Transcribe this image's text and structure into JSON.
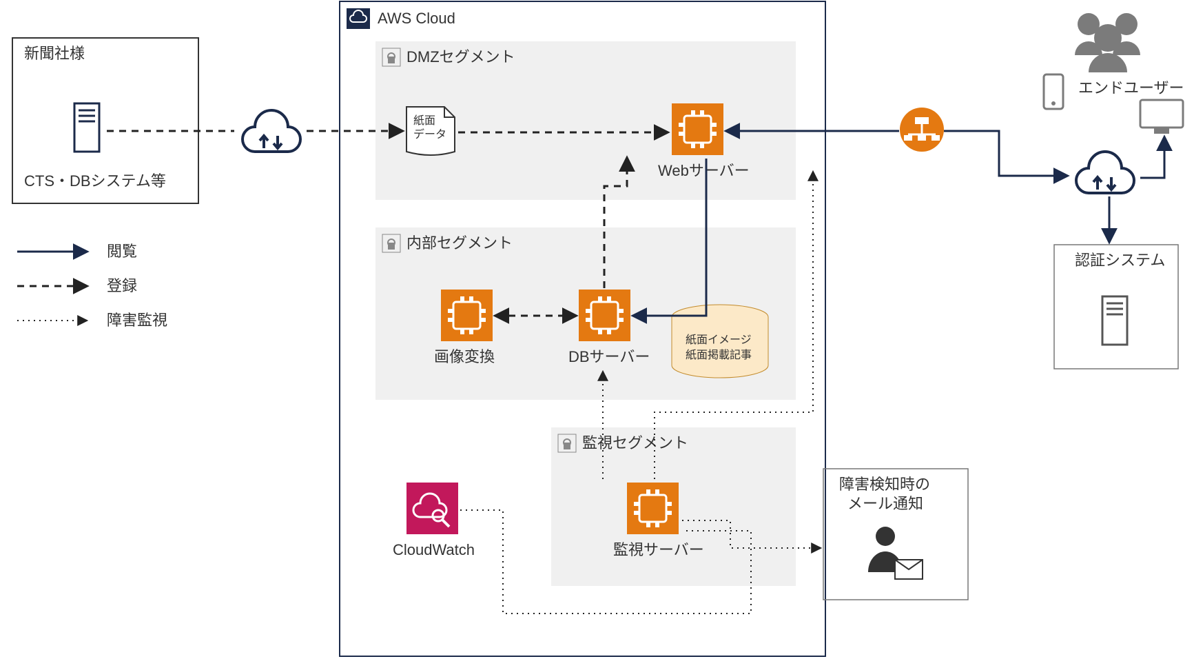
{
  "diagram": {
    "onprem": {
      "title": "新聞社様",
      "subtitle": "CTS・DBシステム等"
    },
    "cloud": {
      "title": "AWS Cloud"
    },
    "segments": {
      "dmz": {
        "title": "DMZセグメント"
      },
      "internal": {
        "title": "内部セグメント"
      },
      "monitor": {
        "title": "監視セグメント"
      }
    },
    "nodes": {
      "paperdata": "紙面\nデータ",
      "webserver": "Webサーバー",
      "imgconv": "画像変換",
      "dbserver": "DBサーバー",
      "storage_l1": "紙面イメージ",
      "storage_l2": "紙面掲載記事",
      "cloudwatch": "CloudWatch",
      "monitorsrv": "監視サーバー",
      "alert_l1": "障害検知時の",
      "alert_l2": "メール通知",
      "enduser": "エンドユーザー",
      "auth": "認証システム"
    },
    "legend": {
      "view": "閲覧",
      "register": "登録",
      "monitor": "障害監視"
    }
  }
}
